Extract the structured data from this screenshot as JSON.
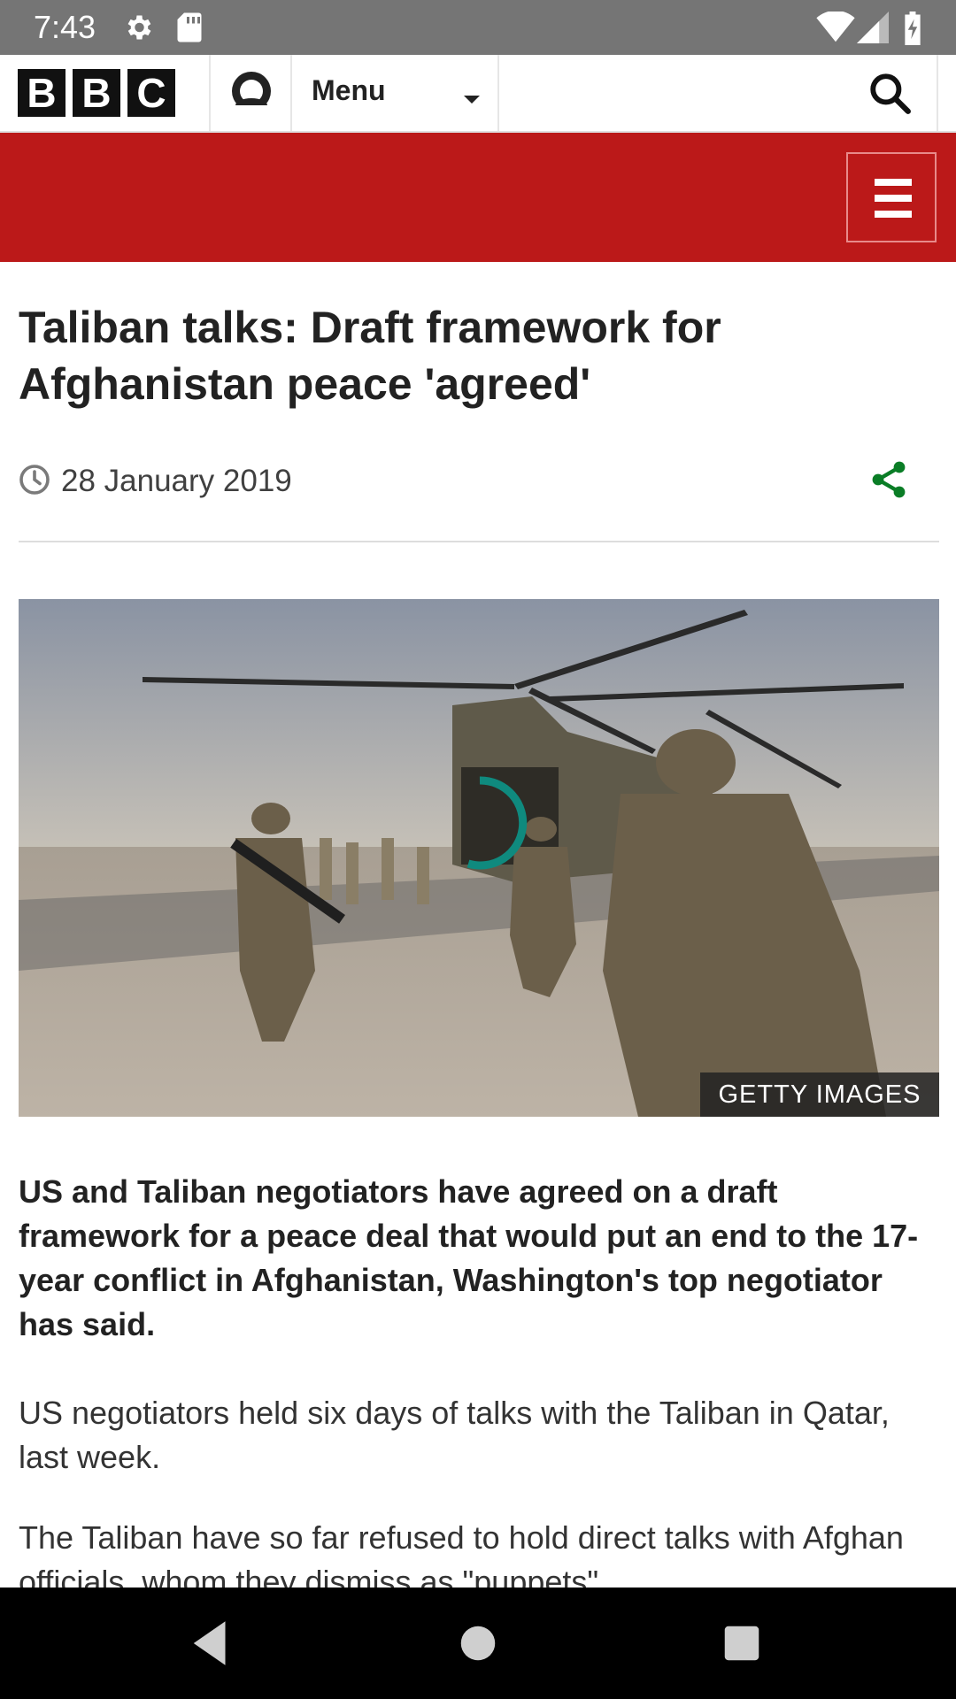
{
  "status_bar": {
    "time": "7:43",
    "left_icons": [
      "settings-gear-icon",
      "sd-card-icon"
    ],
    "right_icons": [
      "wifi-icon",
      "cellular-signal-icon",
      "battery-charging-icon"
    ]
  },
  "top_bar": {
    "logo_letters": [
      "B",
      "B",
      "C"
    ],
    "menu_label": "Menu",
    "icons": [
      "account-icon",
      "search-icon"
    ]
  },
  "red_band": {
    "color": "#bb1919",
    "icon": "hamburger-menu-icon"
  },
  "article": {
    "headline": "Taliban talks: Draft framework for Afghanistan peace 'agreed'",
    "date": "28 January 2019",
    "share_icon": "share-icon",
    "share_color": "#0a7d26",
    "image_credit": "GETTY IMAGES",
    "lead": "US and Taliban negotiators have agreed on a draft framework for a peace deal that would put an end to the 17-year conflict in Afghanistan, Washington's top negotiator has said.",
    "paragraphs": [
      "US negotiators held six days of talks with the Taliban in Qatar, last week.",
      "The Taliban have so far refused to hold direct talks with Afghan officials, whom they dismiss as \"puppets\"."
    ]
  },
  "nav_bar": {
    "icons": [
      "back-icon",
      "home-icon",
      "recents-icon"
    ]
  },
  "colors": {
    "spinner": "#0f8a7e",
    "status_bar": "#757575"
  }
}
